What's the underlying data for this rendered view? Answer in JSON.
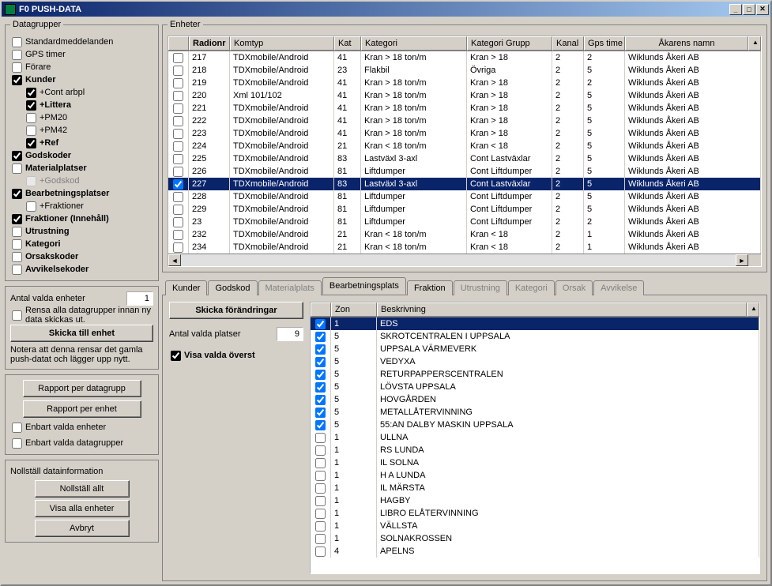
{
  "window": {
    "title": "F0 PUSH-DATA"
  },
  "datagrupper": {
    "legend": "Datagrupper",
    "items": [
      {
        "label": "Standardmeddelanden",
        "checked": false,
        "bold": false,
        "indent": 0,
        "enabled": true
      },
      {
        "label": "GPS timer",
        "checked": false,
        "bold": false,
        "indent": 0,
        "enabled": true
      },
      {
        "label": "Förare",
        "checked": false,
        "bold": false,
        "indent": 0,
        "enabled": true
      },
      {
        "label": "Kunder",
        "checked": true,
        "bold": true,
        "indent": 0,
        "enabled": true
      },
      {
        "label": "+Cont arbpl",
        "checked": true,
        "bold": false,
        "indent": 1,
        "enabled": true
      },
      {
        "label": "+Littera",
        "checked": true,
        "bold": true,
        "indent": 1,
        "enabled": true
      },
      {
        "label": "+PM20",
        "checked": false,
        "bold": false,
        "indent": 1,
        "enabled": true
      },
      {
        "label": "+PM42",
        "checked": false,
        "bold": false,
        "indent": 1,
        "enabled": true
      },
      {
        "label": "+Ref",
        "checked": true,
        "bold": true,
        "indent": 1,
        "enabled": true
      },
      {
        "label": "Godskoder",
        "checked": true,
        "bold": true,
        "indent": 0,
        "enabled": true
      },
      {
        "label": "Materialplatser",
        "checked": false,
        "bold": true,
        "indent": 0,
        "enabled": true
      },
      {
        "label": "+Godskod",
        "checked": false,
        "bold": false,
        "indent": 1,
        "enabled": false
      },
      {
        "label": "Bearbetningsplatser",
        "checked": true,
        "bold": true,
        "indent": 0,
        "enabled": true
      },
      {
        "label": "+Fraktioner",
        "checked": false,
        "bold": false,
        "indent": 1,
        "enabled": true
      },
      {
        "label": "Fraktioner (Innehåll)",
        "checked": true,
        "bold": true,
        "indent": 0,
        "enabled": true
      },
      {
        "label": "Utrustning",
        "checked": false,
        "bold": true,
        "indent": 0,
        "enabled": true
      },
      {
        "label": "Kategori",
        "checked": false,
        "bold": true,
        "indent": 0,
        "enabled": true
      },
      {
        "label": "Orsakskoder",
        "checked": false,
        "bold": true,
        "indent": 0,
        "enabled": true
      },
      {
        "label": "Avvikelsekoder",
        "checked": false,
        "bold": true,
        "indent": 0,
        "enabled": true
      }
    ]
  },
  "selection": {
    "antal_valda_enheter_label": "Antal valda enheter",
    "antal_valda_enheter_value": "1",
    "rensa_label": "Rensa alla datagrupper innan ny data skickas ut.",
    "rensa_checked": false,
    "skicka_button": "Skicka till enhet",
    "note": "Notera att denna rensar det gamla push-datat och lägger upp nytt."
  },
  "reports": {
    "per_datagrupp": "Rapport per datagrupp",
    "per_enhet": "Rapport per enhet",
    "enbart_valda_enheter": {
      "label": "Enbart valda enheter",
      "checked": false
    },
    "enbart_valda_datagrupper": {
      "label": "Enbart valda datagrupper",
      "checked": false
    }
  },
  "bottom_buttons": {
    "nollstall_info": "Nollställ datainformation",
    "nollstall_allt": "Nollställ allt",
    "visa_alla": "Visa alla enheter",
    "avbryt": "Avbryt"
  },
  "enheter": {
    "legend": "Enheter",
    "columns": [
      "",
      "Radionr",
      "Komtyp",
      "Kat",
      "Kategori",
      "Kategori Grupp",
      "Kanal",
      "Gps time",
      "Åkarens namn"
    ],
    "rows": [
      {
        "sel": false,
        "chk": false,
        "radionr": "217",
        "komtyp": "TDXmobile/Android",
        "kat": "41",
        "kategori": "Kran > 18 ton/m",
        "grupp": "Kran > 18",
        "kanal": "2",
        "gps": "2",
        "akare": "Wiklunds Åkeri AB"
      },
      {
        "sel": false,
        "chk": false,
        "radionr": "218",
        "komtyp": "TDXmobile/Android",
        "kat": "23",
        "kategori": "Flakbil",
        "grupp": "Övriga",
        "kanal": "2",
        "gps": "5",
        "akare": "Wiklunds Åkeri AB"
      },
      {
        "sel": false,
        "chk": false,
        "radionr": "219",
        "komtyp": "TDXmobile/Android",
        "kat": "41",
        "kategori": "Kran > 18 ton/m",
        "grupp": "Kran > 18",
        "kanal": "2",
        "gps": "2",
        "akare": "Wiklunds Åkeri AB"
      },
      {
        "sel": false,
        "chk": false,
        "radionr": "220",
        "komtyp": "Xml 101/102",
        "kat": "41",
        "kategori": "Kran > 18 ton/m",
        "grupp": "Kran > 18",
        "kanal": "2",
        "gps": "5",
        "akare": "Wiklunds Åkeri AB"
      },
      {
        "sel": false,
        "chk": false,
        "radionr": "221",
        "komtyp": "TDXmobile/Android",
        "kat": "41",
        "kategori": "Kran > 18 ton/m",
        "grupp": "Kran > 18",
        "kanal": "2",
        "gps": "5",
        "akare": "Wiklunds Åkeri AB"
      },
      {
        "sel": false,
        "chk": false,
        "radionr": "222",
        "komtyp": "TDXmobile/Android",
        "kat": "41",
        "kategori": "Kran > 18 ton/m",
        "grupp": "Kran > 18",
        "kanal": "2",
        "gps": "5",
        "akare": "Wiklunds Åkeri AB"
      },
      {
        "sel": false,
        "chk": false,
        "radionr": "223",
        "komtyp": "TDXmobile/Android",
        "kat": "41",
        "kategori": "Kran > 18 ton/m",
        "grupp": "Kran > 18",
        "kanal": "2",
        "gps": "5",
        "akare": "Wiklunds Åkeri AB"
      },
      {
        "sel": false,
        "chk": false,
        "radionr": "224",
        "komtyp": "TDXmobile/Android",
        "kat": "21",
        "kategori": "Kran < 18 ton/m",
        "grupp": "Kran < 18",
        "kanal": "2",
        "gps": "5",
        "akare": "Wiklunds Åkeri AB"
      },
      {
        "sel": false,
        "chk": false,
        "radionr": "225",
        "komtyp": "TDXmobile/Android",
        "kat": "83",
        "kategori": "Lastväxl 3-axl",
        "grupp": "Cont Lastväxlar",
        "kanal": "2",
        "gps": "5",
        "akare": "Wiklunds Åkeri AB"
      },
      {
        "sel": false,
        "chk": false,
        "radionr": "226",
        "komtyp": "TDXmobile/Android",
        "kat": "81",
        "kategori": "Liftdumper",
        "grupp": "Cont Liftdumper",
        "kanal": "2",
        "gps": "5",
        "akare": "Wiklunds Åkeri AB"
      },
      {
        "sel": true,
        "chk": true,
        "radionr": "227",
        "komtyp": "TDXmobile/Android",
        "kat": "83",
        "kategori": "Lastväxl 3-axl",
        "grupp": "Cont Lastväxlar",
        "kanal": "2",
        "gps": "5",
        "akare": "Wiklunds Åkeri AB"
      },
      {
        "sel": false,
        "chk": false,
        "radionr": "228",
        "komtyp": "TDXmobile/Android",
        "kat": "81",
        "kategori": "Liftdumper",
        "grupp": "Cont Liftdumper",
        "kanal": "2",
        "gps": "5",
        "akare": "Wiklunds Åkeri AB"
      },
      {
        "sel": false,
        "chk": false,
        "radionr": "229",
        "komtyp": "TDXmobile/Android",
        "kat": "81",
        "kategori": "Liftdumper",
        "grupp": "Cont Liftdumper",
        "kanal": "2",
        "gps": "5",
        "akare": "Wiklunds Åkeri AB"
      },
      {
        "sel": false,
        "chk": false,
        "radionr": "23",
        "komtyp": "TDXmobile/Android",
        "kat": "81",
        "kategori": "Liftdumper",
        "grupp": "Cont Liftdumper",
        "kanal": "2",
        "gps": "2",
        "akare": "Wiklunds Åkeri AB"
      },
      {
        "sel": false,
        "chk": false,
        "radionr": "232",
        "komtyp": "TDXmobile/Android",
        "kat": "21",
        "kategori": "Kran < 18 ton/m",
        "grupp": "Kran < 18",
        "kanal": "2",
        "gps": "1",
        "akare": "Wiklunds Åkeri AB"
      },
      {
        "sel": false,
        "chk": false,
        "radionr": "234",
        "komtyp": "TDXmobile/Android",
        "kat": "21",
        "kategori": "Kran < 18 ton/m",
        "grupp": "Kran < 18",
        "kanal": "2",
        "gps": "1",
        "akare": "Wiklunds Åkeri AB"
      }
    ]
  },
  "tabs": [
    {
      "label": "Kunder",
      "enabled": true
    },
    {
      "label": "Godskod",
      "enabled": true
    },
    {
      "label": "Materialplats",
      "enabled": false
    },
    {
      "label": "Bearbetningsplats",
      "enabled": true,
      "active": true
    },
    {
      "label": "Fraktion",
      "enabled": true
    },
    {
      "label": "Utrustning",
      "enabled": false
    },
    {
      "label": "Kategori",
      "enabled": false
    },
    {
      "label": "Orsak",
      "enabled": false
    },
    {
      "label": "Avvikelse",
      "enabled": false
    }
  ],
  "tabpanel": {
    "skicka_forandringar": "Skicka förändringar",
    "antal_valda_platser_label": "Antal valda platser",
    "antal_valda_platser_value": "9",
    "visa_valda_overst": {
      "label": "Visa valda överst",
      "checked": true
    },
    "grid_columns": [
      "",
      "Zon",
      "Beskrivning"
    ],
    "grid_rows": [
      {
        "sel": true,
        "chk": true,
        "zon": "1",
        "besk": "EDS"
      },
      {
        "sel": false,
        "chk": true,
        "zon": "5",
        "besk": "SKROTCENTRALEN I UPPSALA"
      },
      {
        "sel": false,
        "chk": true,
        "zon": "5",
        "besk": "UPPSALA VÄRMEVERK"
      },
      {
        "sel": false,
        "chk": true,
        "zon": "5",
        "besk": "VEDYXA"
      },
      {
        "sel": false,
        "chk": true,
        "zon": "5",
        "besk": "RETURPAPPERSCENTRALEN"
      },
      {
        "sel": false,
        "chk": true,
        "zon": "5",
        "besk": "LÖVSTA UPPSALA"
      },
      {
        "sel": false,
        "chk": true,
        "zon": "5",
        "besk": "HOVGÅRDEN"
      },
      {
        "sel": false,
        "chk": true,
        "zon": "5",
        "besk": "METALLÅTERVINNING"
      },
      {
        "sel": false,
        "chk": true,
        "zon": "5",
        "besk": "55:AN DALBY MASKIN UPPSALA"
      },
      {
        "sel": false,
        "chk": false,
        "zon": "1",
        "besk": "ULLNA"
      },
      {
        "sel": false,
        "chk": false,
        "zon": "1",
        "besk": "RS LUNDA"
      },
      {
        "sel": false,
        "chk": false,
        "zon": "1",
        "besk": "IL SOLNA"
      },
      {
        "sel": false,
        "chk": false,
        "zon": "1",
        "besk": "H A LUNDA"
      },
      {
        "sel": false,
        "chk": false,
        "zon": "1",
        "besk": "IL MÄRSTA"
      },
      {
        "sel": false,
        "chk": false,
        "zon": "1",
        "besk": "HAGBY"
      },
      {
        "sel": false,
        "chk": false,
        "zon": "1",
        "besk": "LIBRO ELÅTERVINNING"
      },
      {
        "sel": false,
        "chk": false,
        "zon": "1",
        "besk": "VÄLLSTA"
      },
      {
        "sel": false,
        "chk": false,
        "zon": "1",
        "besk": "SOLNAKROSSEN"
      },
      {
        "sel": false,
        "chk": false,
        "zon": "4",
        "besk": "APELNS"
      }
    ]
  }
}
